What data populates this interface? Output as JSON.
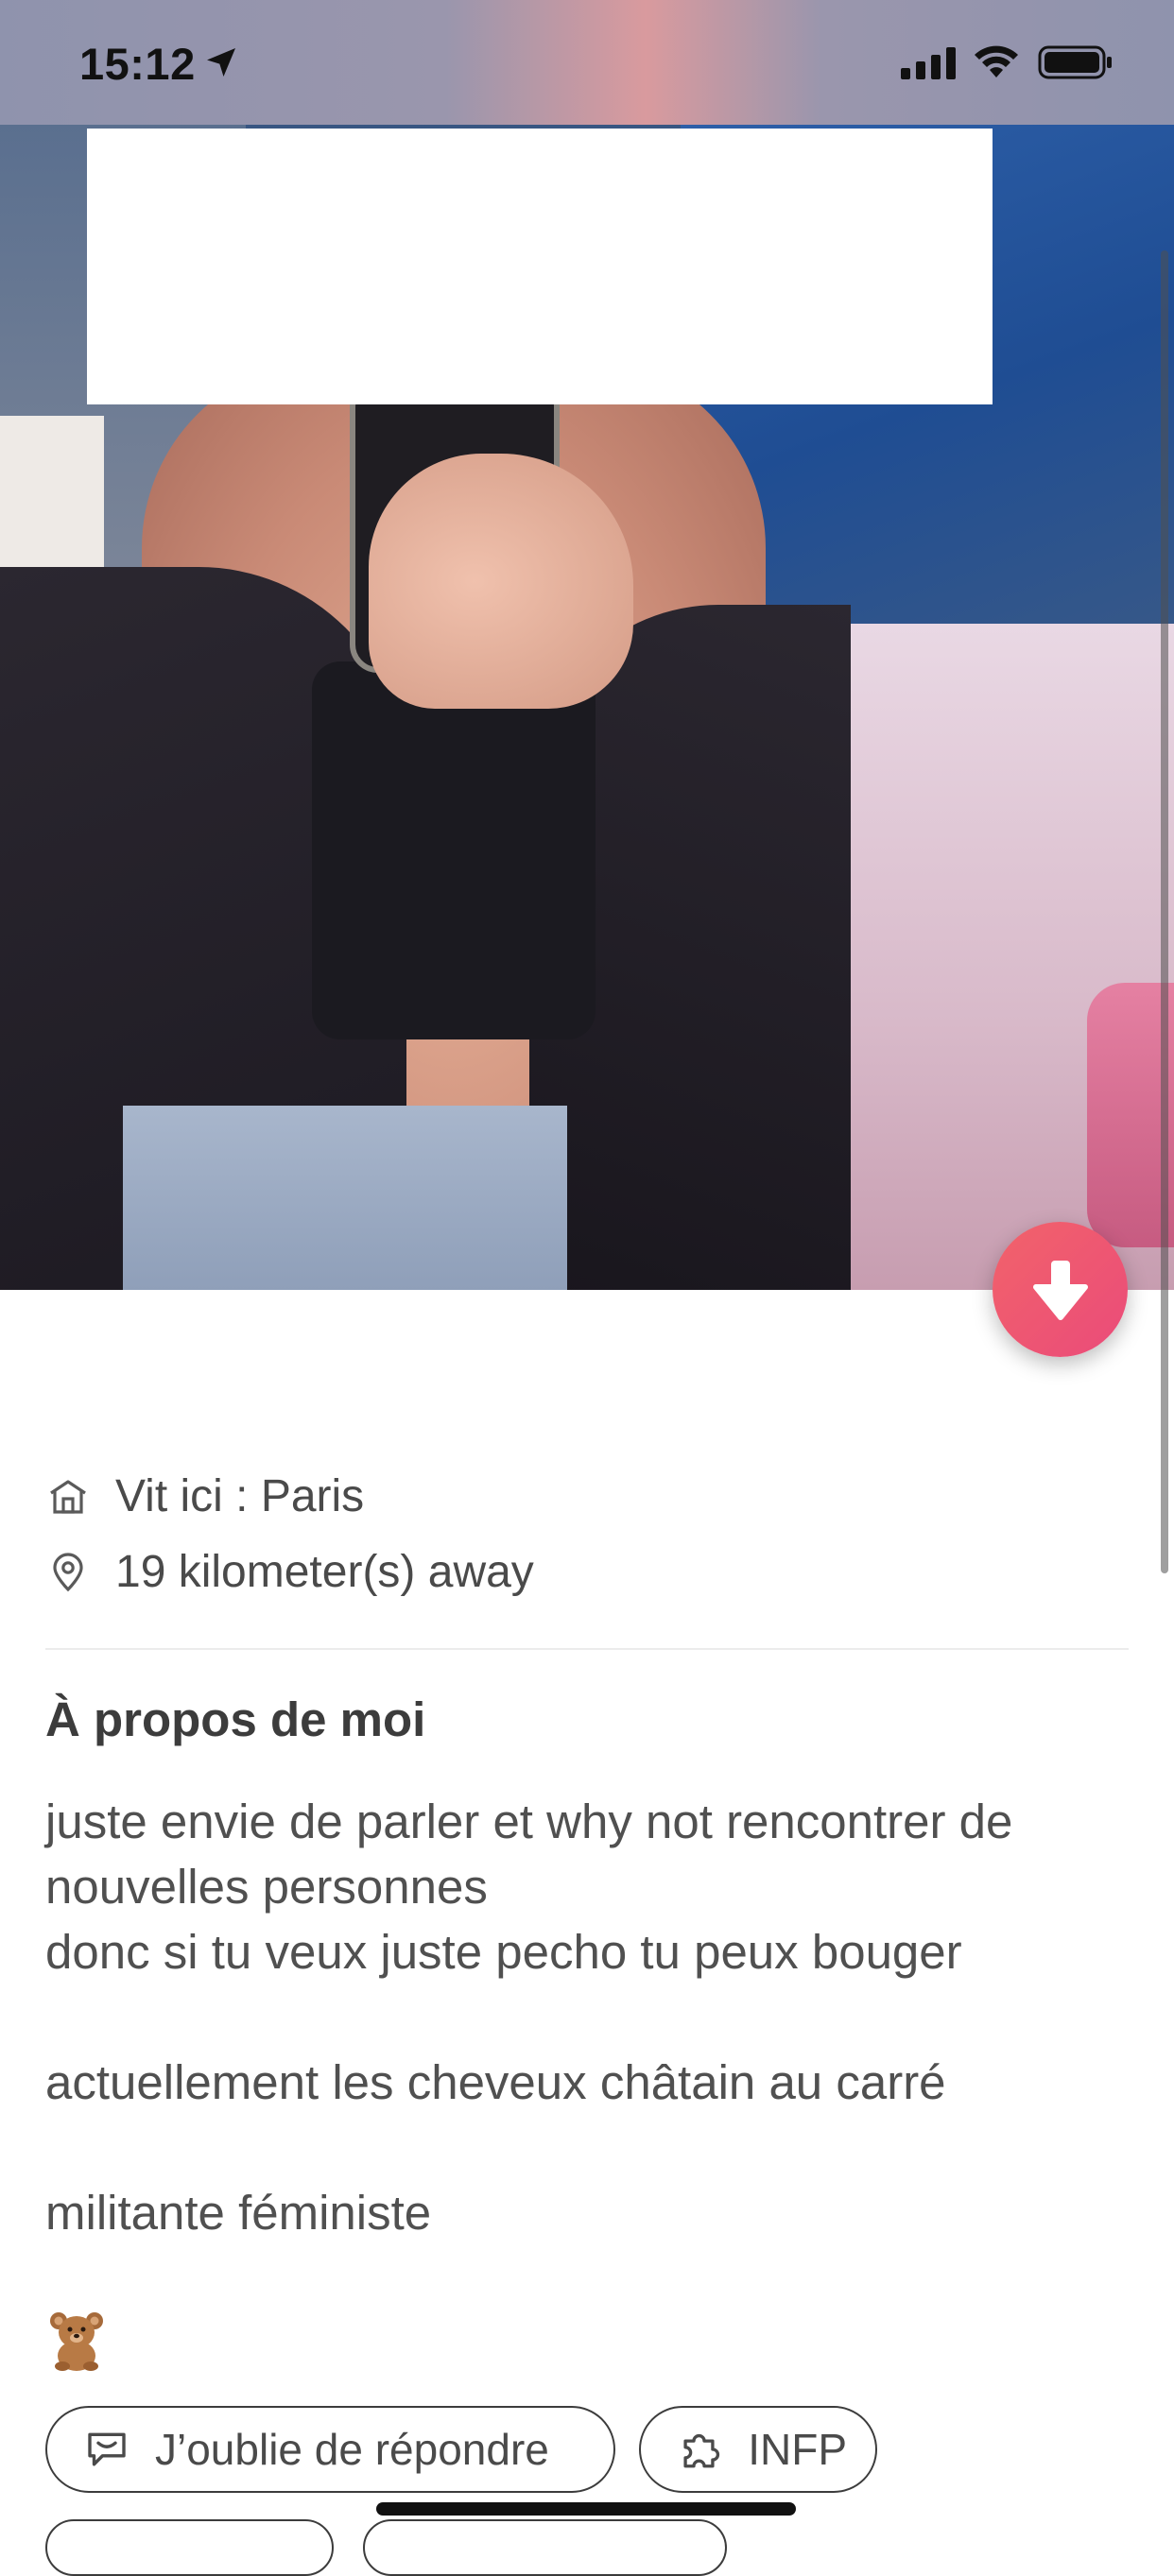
{
  "status_bar": {
    "time": "15:12",
    "location_icon": "location-arrow-icon",
    "signal_icon": "cellular-signal-icon",
    "wifi_icon": "wifi-icon",
    "battery_icon": "battery-icon"
  },
  "profile": {
    "photo_icon": "profile-photo",
    "scroll_down_icon": "arrow-down-icon",
    "accent_color": "#EF5B73",
    "lives_in": {
      "icon": "home-icon",
      "text": "Vit ici : Paris"
    },
    "distance": {
      "icon": "location-pin-icon",
      "text": "19 kilometer(s) away"
    },
    "about": {
      "title": "À propos de moi",
      "lines": [
        "juste envie de parler et why not rencontrer de",
        "nouvelles personnes",
        "donc si tu veux juste pecho tu peux bouger",
        "actuellement les cheveux châtain au carré",
        "militante féministe"
      ],
      "emoji_icon": "teddy-bear-icon"
    },
    "chips": [
      {
        "icon": "speech-bubble-icon",
        "label": "J’oublie de répondre"
      },
      {
        "icon": "puzzle-icon",
        "label": "INFP"
      }
    ]
  }
}
